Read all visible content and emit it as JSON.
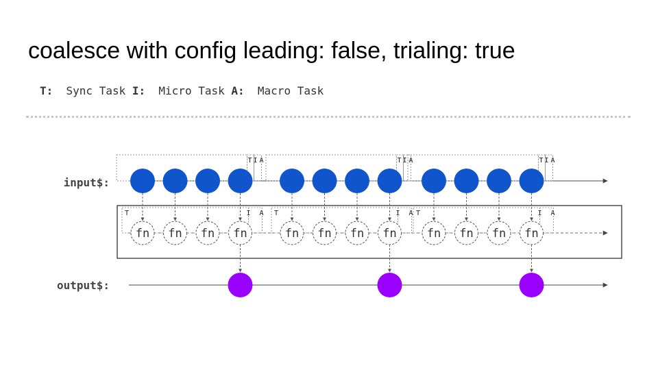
{
  "title": "coalesce with config leading: false, trialing: true",
  "legend": [
    {
      "key": "T:",
      "text": "Sync Task"
    },
    {
      "key": "I:",
      "text": "Micro Task"
    },
    {
      "key": "A:",
      "text": "Macro Task"
    }
  ],
  "streams": {
    "input_label": "input$:",
    "output_label": "output$:"
  },
  "fn_label": "fn",
  "markers": {
    "sync": "T",
    "micro": "I",
    "macro": "A"
  },
  "groups": [
    {
      "input_count": 4,
      "emits_output": true
    },
    {
      "input_count": 4,
      "emits_output": true
    },
    {
      "input_count": 4,
      "emits_output": true
    }
  ],
  "colors": {
    "input_marble": "#1155cc",
    "output_marble": "#9900ff",
    "line": "#444444",
    "dashed": "#666666"
  }
}
